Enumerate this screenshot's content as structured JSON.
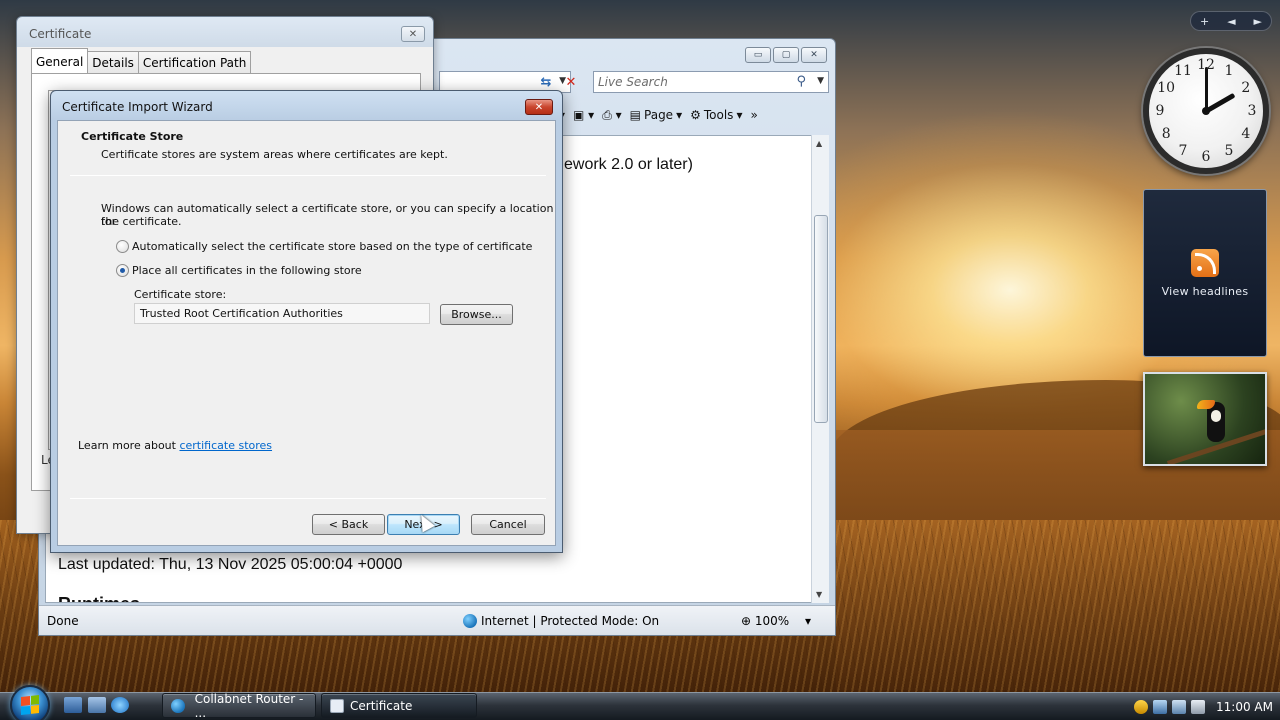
{
  "desktop": {
    "feed_gadget_label": "View headlines",
    "sidebar_controls": [
      "+",
      "◄",
      "►"
    ],
    "clock": {
      "numbers": [
        "12",
        "1",
        "2",
        "3",
        "4",
        "5",
        "6",
        "7",
        "8",
        "9",
        "10",
        "11"
      ],
      "time_shown": "11:00",
      "hour_hand_deg": 60,
      "minute_hand_deg": 0
    },
    "photo_gadget_icon": "toucan-photo"
  },
  "ie": {
    "window_buttons": [
      "▭",
      "▢",
      "✕"
    ],
    "search_placeholder": "Live Search",
    "command_bar": {
      "page_label": "Page",
      "tools_label": "Tools"
    },
    "content": {
      "framework_text": "ework 2.0 or later)",
      "last_updated": "Last updated: Thu, 13 Nov 2025 05:00:04 +0000",
      "heading_partial": "Runtimes"
    },
    "status": {
      "left": "Done",
      "zone": "Internet | Protected Mode: On",
      "zoom": "100%"
    }
  },
  "cert_window": {
    "title": "Certificate",
    "tabs": [
      "General",
      "Details",
      "Certification Path"
    ],
    "partial_text": "Le"
  },
  "wizard": {
    "title": "Certificate Import Wizard",
    "header_title": "Certificate Store",
    "header_desc": "Certificate stores are system areas where certificates are kept.",
    "intro_line1": "Windows can automatically select a certificate store, or you can specify a location for",
    "intro_line2": "the certificate.",
    "radio_auto": "Automatically select the certificate store based on the type of certificate",
    "radio_place": "Place all certificates in the following store",
    "selected_option": "place",
    "store_label": "Certificate store:",
    "store_value": "Trusted Root Certification Authorities",
    "browse_label": "Browse...",
    "learn_more_prefix": "Learn more about ",
    "learn_more_link": "certificate stores",
    "back_label": "< Back",
    "next_label": "Next >",
    "cancel_label": "Cancel"
  },
  "taskbar": {
    "tasks": [
      {
        "label": "Collabnet Router - ...",
        "icon": "ie-icon"
      },
      {
        "label": "Certificate",
        "icon": "certificate-icon"
      }
    ],
    "clock": "11:00 AM"
  }
}
